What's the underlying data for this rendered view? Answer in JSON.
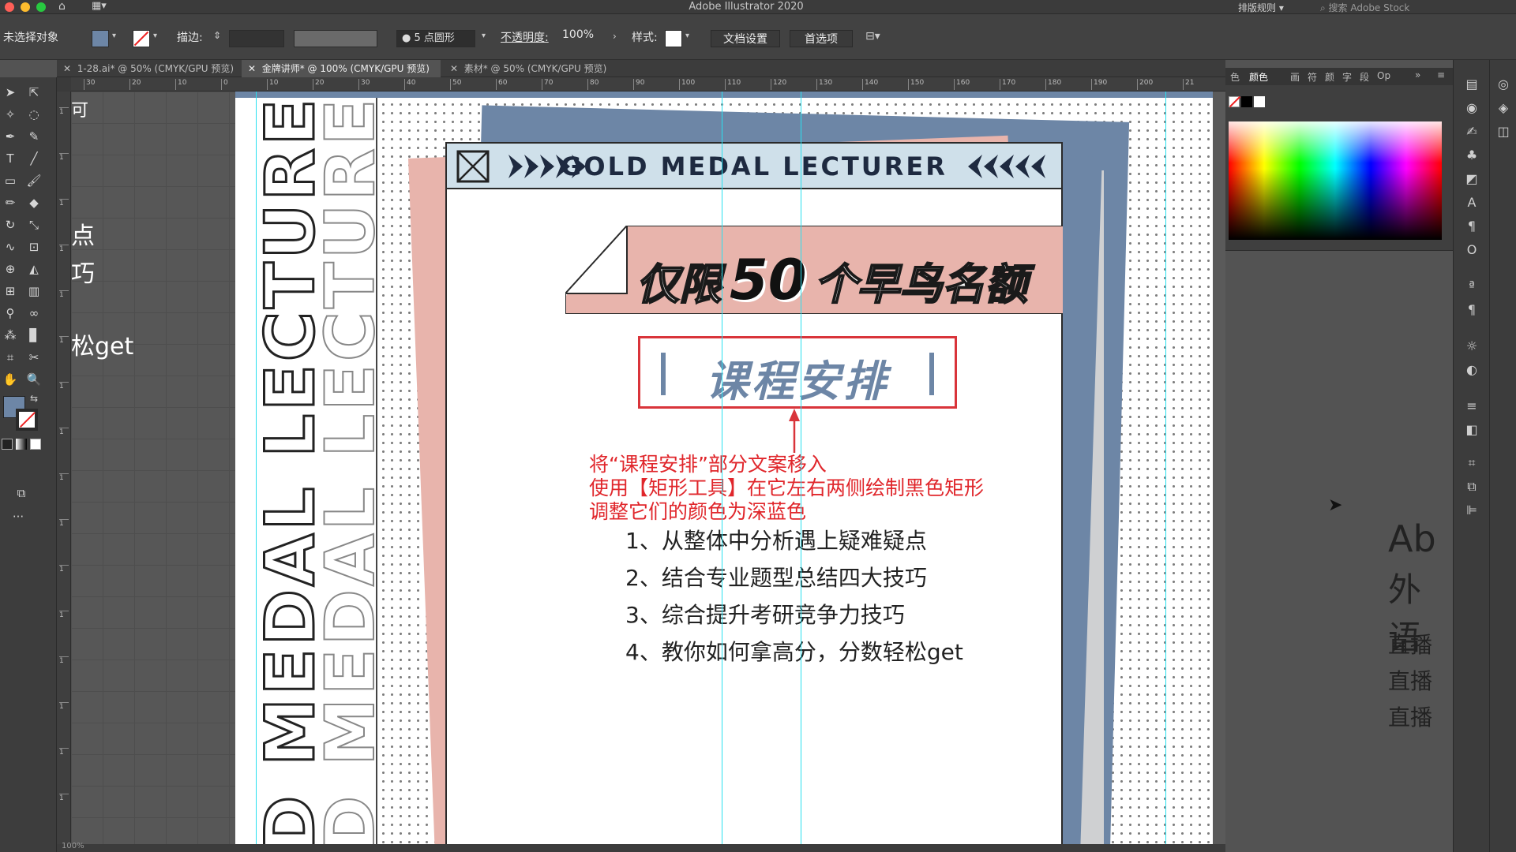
{
  "window": {
    "title": "Adobe Illustrator 2020",
    "workspace": "排版规则",
    "search_placeholder": "搜索 Adobe Stock"
  },
  "control_bar": {
    "selection": "未选择对象",
    "stroke_label": "描边:",
    "brush": "5 点圆形",
    "opacity_label": "不透明度:",
    "opacity_value": "100%",
    "style_label": "样式:",
    "doc_setup": "文档设置",
    "preferences": "首选项"
  },
  "tabs": [
    {
      "label": "1-28.ai* @ 50% (CMYK/GPU 预览)"
    },
    {
      "label": "金牌讲师* @ 100% (CMYK/GPU 预览)"
    },
    {
      "label": "素材* @ 50% (CMYK/GPU 预览)"
    }
  ],
  "ruler_h": [
    "30",
    "20",
    "10",
    "0",
    "10",
    "20",
    "30",
    "40",
    "50",
    "60",
    "70",
    "80",
    "90",
    "100",
    "110",
    "120",
    "130",
    "140",
    "150",
    "160",
    "170",
    "180",
    "190",
    "200",
    "21"
  ],
  "ruler_v": [
    "1",
    "1",
    "1",
    "1",
    "1",
    "1",
    "1",
    "1",
    "1",
    "1",
    "1",
    "1",
    "1",
    "1",
    "1",
    "1"
  ],
  "left_peek": {
    "t1": "可",
    "t2": "点",
    "t3": "巧",
    "t4": "松get"
  },
  "design": {
    "vertical_text": "D MEDAL LECTURER",
    "header": "GOLD MEDAL LECTURER",
    "banner_a": "仅限",
    "banner_num": "50",
    "banner_b": "个早鸟名额",
    "section_title": "课程安排",
    "annotations": [
      "将“课程安排”部分文案移入",
      "使用【矩形工具】在它左右两侧绘制黑色矩形",
      "调整它们的颜色为深蓝色"
    ],
    "items": [
      "1、从整体中分析遇上疑难疑点",
      "2、结合专业题型总结四大技巧",
      "3、综合提升考研竞争力技巧",
      "4、教你如何拿高分，分数轻松get"
    ]
  },
  "color_panel": {
    "tabs": [
      "色",
      "颜色",
      "画",
      "符",
      "颜",
      "字",
      "段",
      "Op"
    ]
  },
  "right_peek": {
    "p1": "Ab",
    "p2": "外语",
    "p3": "直播",
    "p4": "直播",
    "p5": "直播"
  },
  "colors": {
    "accent_pink": "#e8b4ac",
    "steel_blue": "#6d86a6",
    "header_blue": "#cfe0ea",
    "red": "#d9343a",
    "guide": "#29e0ef",
    "ui_dark": "#424242"
  },
  "status": {
    "zoom": "100%"
  }
}
